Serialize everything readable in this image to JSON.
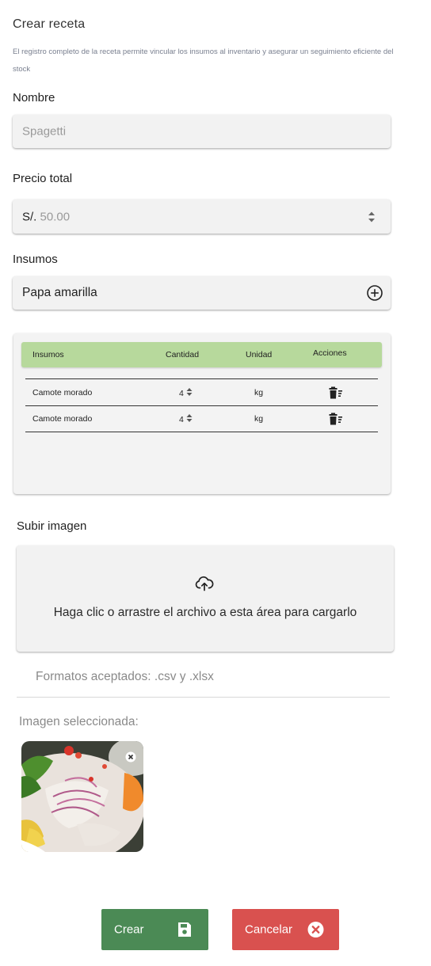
{
  "header": {
    "title": "Crear receta",
    "description": "El registro completo de la receta permite vincular los insumos al inventario y asegurar un seguimiento eficiente del stock"
  },
  "form": {
    "nombre": {
      "label": "Nombre",
      "placeholder": "Spagetti"
    },
    "precio": {
      "label": "Precio total",
      "prefix": "S/.",
      "placeholder": "50.00"
    },
    "insumos": {
      "label": "Insumos",
      "value": "Papa amarilla",
      "add_icon": "plus-circle-icon"
    }
  },
  "table": {
    "headers": [
      "Insumos",
      "Cantidad",
      "Unidad",
      "Acciones"
    ],
    "rows": [
      {
        "insumo": "Camote morado",
        "cantidad": "4",
        "unidad": "kg"
      },
      {
        "insumo": "Camote morado",
        "cantidad": "4",
        "unidad": "kg"
      }
    ],
    "row_action_icon": "trash-icon"
  },
  "upload": {
    "label": "Subir imagen",
    "text": "Haga clic o arrastre el archivo a esta área para cargarlo",
    "icon": "cloud-upload-icon",
    "formats": "Formatos aceptados: .csv y .xlsx",
    "selected_label": "Imagen seleccionada:"
  },
  "actions": {
    "create_label": "Crear",
    "create_icon": "save-icon",
    "cancel_label": "Cancelar",
    "cancel_icon": "close-circle-icon"
  },
  "colors": {
    "table_header": "#b7d99c",
    "create_button": "#4b8a55",
    "cancel_button": "#d9514f"
  }
}
